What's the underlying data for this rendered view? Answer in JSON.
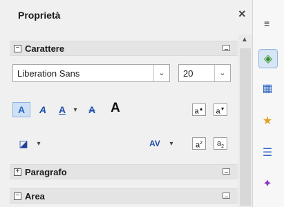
{
  "sidebar": {
    "title": "Proprietà",
    "close_glyph": "×",
    "menu_glyph": "≡"
  },
  "character": {
    "header": "Carattere",
    "font_name": "Liberation Sans",
    "font_size": "20",
    "toolbar_icons": [
      "shadow-icon",
      "italic-a-icon",
      "underline-a-icon",
      "strikethrough-a-icon",
      "bold-a-icon",
      "grow-font-icon",
      "shrink-font-icon",
      "font-color-icon",
      "character-spacing-icon",
      "superscript-icon",
      "subscript-icon"
    ]
  },
  "sections": {
    "paragraph": "Paragrafo",
    "area": "Area"
  },
  "tabbar": {
    "tabs": [
      "properties-tab",
      "styles-tab",
      "gallery-tab",
      "navigator-tab",
      "animation-tab"
    ]
  }
}
